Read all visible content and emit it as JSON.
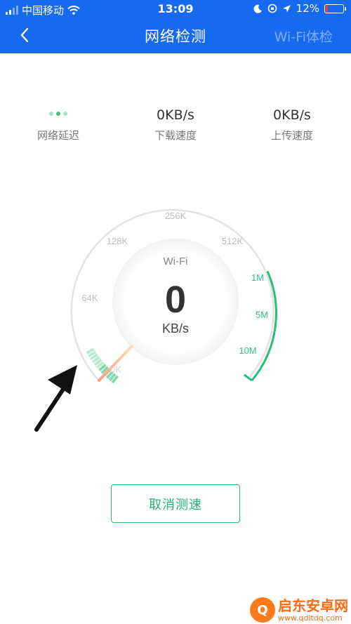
{
  "status_bar": {
    "carrier": "中国移动",
    "time": "13:09",
    "battery": "12%",
    "battery_level": 0.12
  },
  "nav": {
    "title": "网络检测",
    "right_action": "Wi-Fi体检"
  },
  "stats": {
    "latency_label": "网络延迟",
    "download_value": "0KB/s",
    "download_label": "下载速度",
    "upload_value": "0KB/s",
    "upload_label": "上传速度"
  },
  "gauge": {
    "network": "Wi-Fi",
    "value": "0",
    "unit": "KB/s",
    "ticks": [
      "0K",
      "64K",
      "128K",
      "256K",
      "512K",
      "1M",
      "5M",
      "10M"
    ]
  },
  "buttons": {
    "cancel": "取消测速"
  },
  "watermark": {
    "name": "启东安卓网",
    "url": "www.qdltdq.com"
  },
  "colors": {
    "header": "#1769f0",
    "accent_green": "#2db77b"
  }
}
